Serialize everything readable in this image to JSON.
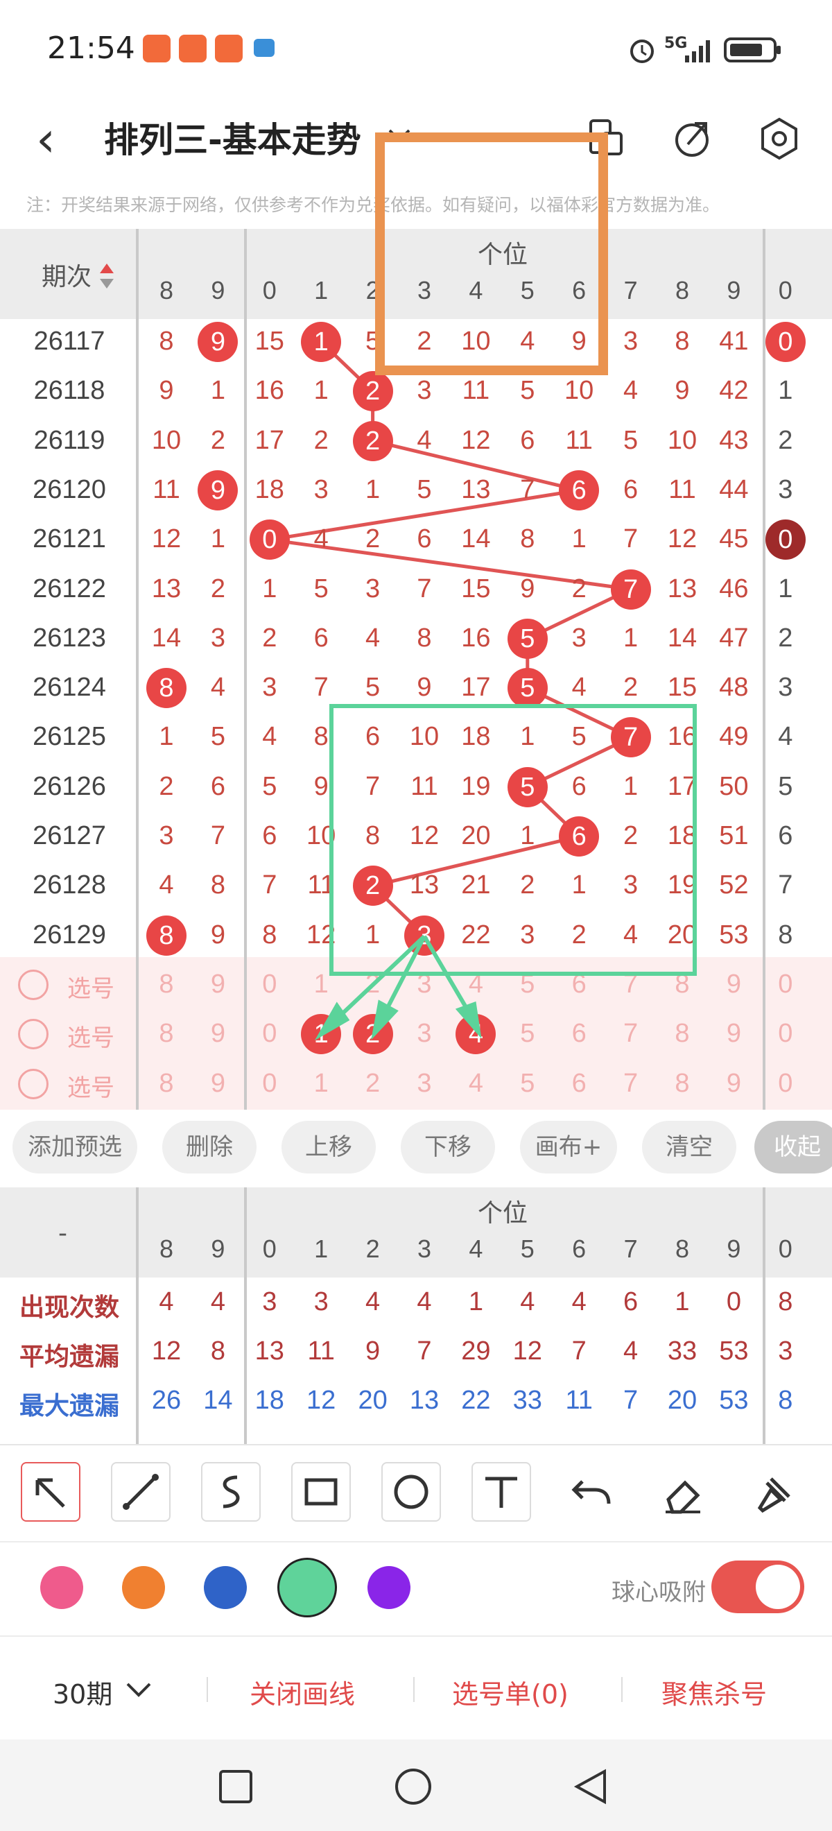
{
  "status": {
    "time": "21:54",
    "network": "5G"
  },
  "header": {
    "title": "排列三-基本走势"
  },
  "note": "注：开奖结果来源于网络，仅供参考不作为兑奖依据。如有疑问，以福体彩官方数据为准。",
  "table": {
    "period_label": "期次",
    "section_label": "个位",
    "col_headers": [
      "8",
      "9",
      "0",
      "1",
      "2",
      "3",
      "4",
      "5",
      "6",
      "7",
      "8",
      "9",
      "0"
    ],
    "rows": [
      {
        "period": "26117",
        "cells": [
          "8",
          "9",
          "15",
          "1",
          "5",
          "2",
          "10",
          "4",
          "9",
          "3",
          "8",
          "41",
          "0"
        ],
        "balls": [
          1,
          3,
          12
        ]
      },
      {
        "period": "26118",
        "cells": [
          "9",
          "1",
          "16",
          "1",
          "2",
          "3",
          "11",
          "5",
          "10",
          "4",
          "9",
          "42",
          "1"
        ],
        "balls": [
          4
        ]
      },
      {
        "period": "26119",
        "cells": [
          "10",
          "2",
          "17",
          "2",
          "2",
          "4",
          "12",
          "6",
          "11",
          "5",
          "10",
          "43",
          "2"
        ],
        "balls": [
          4
        ]
      },
      {
        "period": "26120",
        "cells": [
          "11",
          "9",
          "18",
          "3",
          "1",
          "5",
          "13",
          "7",
          "6",
          "6",
          "11",
          "44",
          "3"
        ],
        "balls": [
          1,
          8
        ]
      },
      {
        "period": "26121",
        "cells": [
          "12",
          "1",
          "0",
          "4",
          "2",
          "6",
          "14",
          "8",
          "1",
          "7",
          "12",
          "45",
          "0"
        ],
        "balls": [
          2,
          12
        ]
      },
      {
        "period": "26122",
        "cells": [
          "13",
          "2",
          "1",
          "5",
          "3",
          "7",
          "15",
          "9",
          "2",
          "7",
          "13",
          "46",
          "1"
        ],
        "balls": [
          9
        ]
      },
      {
        "period": "26123",
        "cells": [
          "14",
          "3",
          "2",
          "6",
          "4",
          "8",
          "16",
          "5",
          "3",
          "1",
          "14",
          "47",
          "2"
        ],
        "balls": [
          7
        ]
      },
      {
        "period": "26124",
        "cells": [
          "8",
          "4",
          "3",
          "7",
          "5",
          "9",
          "17",
          "5",
          "4",
          "2",
          "15",
          "48",
          "3"
        ],
        "balls": [
          0,
          7
        ]
      },
      {
        "period": "26125",
        "cells": [
          "1",
          "5",
          "4",
          "8",
          "6",
          "10",
          "18",
          "1",
          "5",
          "7",
          "16",
          "49",
          "4"
        ],
        "balls": [
          9
        ]
      },
      {
        "period": "26126",
        "cells": [
          "2",
          "6",
          "5",
          "9",
          "7",
          "11",
          "19",
          "5",
          "6",
          "1",
          "17",
          "50",
          "5"
        ],
        "balls": [
          7
        ]
      },
      {
        "period": "26127",
        "cells": [
          "3",
          "7",
          "6",
          "10",
          "8",
          "12",
          "20",
          "1",
          "6",
          "2",
          "18",
          "51",
          "6"
        ],
        "balls": [
          8
        ]
      },
      {
        "period": "26128",
        "cells": [
          "4",
          "8",
          "7",
          "11",
          "2",
          "13",
          "21",
          "2",
          "1",
          "3",
          "19",
          "52",
          "7"
        ],
        "balls": [
          4
        ]
      },
      {
        "period": "26129",
        "cells": [
          "8",
          "9",
          "8",
          "12",
          "1",
          "3",
          "22",
          "3",
          "2",
          "4",
          "20",
          "53",
          "8"
        ],
        "balls": [
          0,
          5
        ]
      }
    ],
    "select_label": "选号",
    "select_rows": [
      {
        "cells": [
          "8",
          "9",
          "0",
          "1",
          "2",
          "3",
          "4",
          "5",
          "6",
          "7",
          "8",
          "9",
          "0"
        ],
        "balls": []
      },
      {
        "cells": [
          "8",
          "9",
          "0",
          "1",
          "2",
          "3",
          "4",
          "5",
          "6",
          "7",
          "8",
          "9",
          "0"
        ],
        "balls": [
          3,
          4,
          6
        ]
      },
      {
        "cells": [
          "8",
          "9",
          "0",
          "1",
          "2",
          "3",
          "4",
          "5",
          "6",
          "7",
          "8",
          "9",
          "0"
        ],
        "balls": []
      }
    ]
  },
  "actions": [
    "添加预选",
    "删除",
    "上移",
    "下移",
    "画布+",
    "清空",
    "收起"
  ],
  "stats": {
    "dash": "-",
    "section_label": "个位",
    "col_headers": [
      "8",
      "9",
      "0",
      "1",
      "2",
      "3",
      "4",
      "5",
      "6",
      "7",
      "8",
      "9",
      "0"
    ],
    "rows": [
      {
        "label": "出现次数",
        "values": [
          "4",
          "4",
          "3",
          "3",
          "4",
          "4",
          "1",
          "4",
          "4",
          "6",
          "1",
          "0",
          "8"
        ],
        "color": "#b23a3a"
      },
      {
        "label": "平均遗漏",
        "values": [
          "12",
          "8",
          "13",
          "11",
          "9",
          "7",
          "29",
          "12",
          "7",
          "4",
          "33",
          "53",
          "3"
        ],
        "color": "#b23a3a"
      },
      {
        "label": "最大遗漏",
        "values": [
          "26",
          "14",
          "18",
          "12",
          "20",
          "13",
          "22",
          "33",
          "11",
          "7",
          "20",
          "53",
          "8"
        ],
        "color": "#3a6ed0"
      }
    ]
  },
  "tools": [
    "arrow-tool",
    "line-tool",
    "curve-tool",
    "rect-tool",
    "circle-tool",
    "text-tool",
    "undo-tool",
    "eraser-tool",
    "brush-tool"
  ],
  "colors": [
    "#ef5b8c",
    "#f08030",
    "#2f63c8",
    "#5fd39a",
    "#8a25e8"
  ],
  "snap": {
    "label": "球心吸附",
    "on": true
  },
  "bottom": {
    "period": "30期",
    "close_lines": "关闭画线",
    "pick_list": "选号单(0)",
    "focus_kill": "聚焦杀号"
  }
}
